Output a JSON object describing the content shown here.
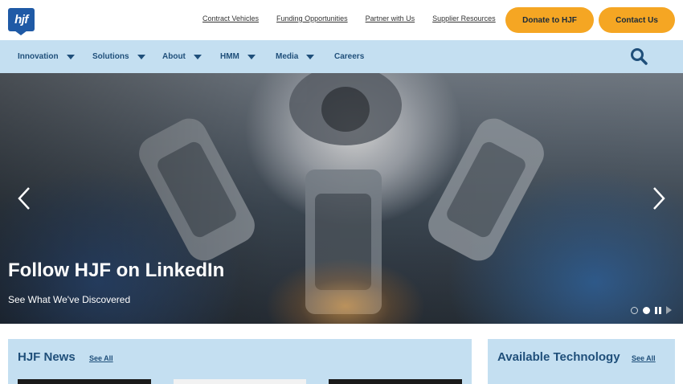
{
  "brand": {
    "logo_text": "hjf"
  },
  "utility_links": [
    "Contract Vehicles",
    "Funding Opportunities",
    "Partner with Us",
    "Supplier Resources"
  ],
  "buttons": {
    "donate": "Donate to HJF",
    "contact": "Contact Us"
  },
  "nav": {
    "items": [
      {
        "label": "Innovation",
        "has_dropdown": true
      },
      {
        "label": "Solutions",
        "has_dropdown": true
      },
      {
        "label": "About",
        "has_dropdown": true
      },
      {
        "label": "HMM",
        "has_dropdown": true
      },
      {
        "label": "Media",
        "has_dropdown": true
      },
      {
        "label": "Careers",
        "has_dropdown": false
      }
    ],
    "search_icon": "search-icon"
  },
  "hero": {
    "title": "Follow HJF on LinkedIn",
    "subtitle": "See What We've Discovered",
    "slide_count": 2,
    "active_slide": 2
  },
  "news": {
    "title": "HJF News",
    "see_all": "See All"
  },
  "tech": {
    "title": "Available Technology",
    "see_all": "See All"
  },
  "colors": {
    "accent": "#f5a623",
    "nav_bg": "#c4dff1",
    "brand_blue": "#1f5aa6",
    "nav_text": "#1f4f7a"
  }
}
